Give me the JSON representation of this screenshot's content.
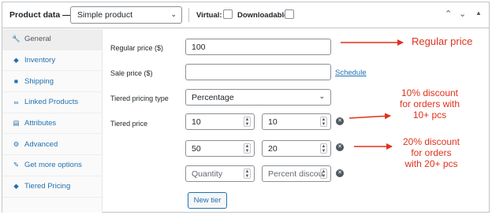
{
  "header": {
    "title": "Product data —",
    "product_type": "Simple product",
    "virtual_label": "Virtual:",
    "downloadable_label": "Downloadable:"
  },
  "sidebar": {
    "items": [
      {
        "label": "General",
        "icon": "wrench-icon"
      },
      {
        "label": "Inventory",
        "icon": "tag-icon"
      },
      {
        "label": "Shipping",
        "icon": "truck-icon"
      },
      {
        "label": "Linked Products",
        "icon": "link-icon"
      },
      {
        "label": "Attributes",
        "icon": "list-icon"
      },
      {
        "label": "Advanced",
        "icon": "gear-icon"
      },
      {
        "label": "Get more options",
        "icon": "plugin-icon"
      },
      {
        "label": "Tiered Pricing",
        "icon": "tag-icon"
      }
    ]
  },
  "form": {
    "regular_price_label": "Regular price ($)",
    "regular_price_value": "100",
    "sale_price_label": "Sale price ($)",
    "sale_price_value": "",
    "schedule_link": "Schedule",
    "tiered_type_label": "Tiered pricing type",
    "tiered_type_value": "Percentage",
    "tiered_price_label": "Tiered price",
    "tiers": [
      {
        "quantity": "10",
        "discount": "10"
      },
      {
        "quantity": "50",
        "discount": "20"
      }
    ],
    "new_tier_placeholders": {
      "quantity": "Quantity",
      "discount": "Percent discou"
    },
    "new_tier_button": "New tier"
  },
  "annotations": {
    "regular_price": "Regular price",
    "tier1": [
      "10% discount",
      "for orders with",
      "10+ pcs"
    ],
    "tier2": [
      "20% discount",
      "for orders",
      "with 20+ pcs"
    ],
    "color": "#e0321c"
  }
}
